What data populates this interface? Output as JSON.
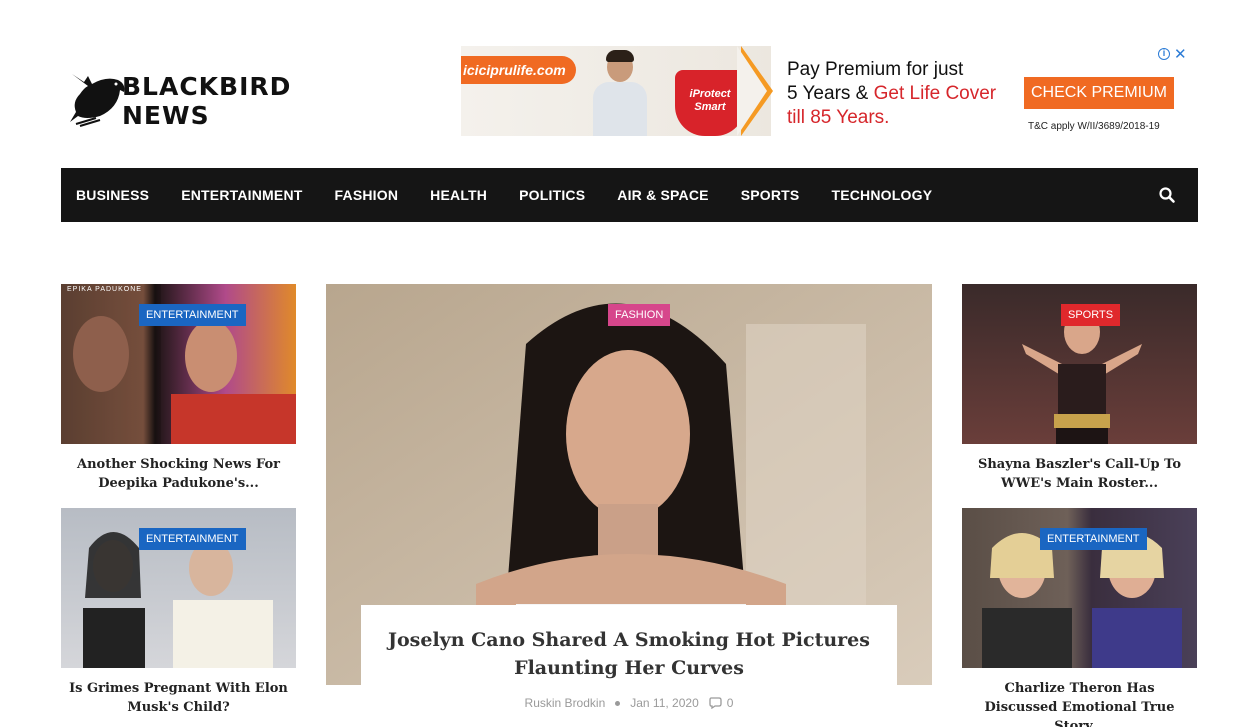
{
  "site": {
    "logo_text": "BLACKBIRD NEWS"
  },
  "ad": {
    "url_label": "iciciprulife.com",
    "badge": "iProtect Smart",
    "line1": "Pay Premium for just",
    "line2_prefix": "5 Years & ",
    "line2_highlight": "Get Life Cover",
    "line3": "till 85 Years.",
    "cta": "CHECK PREMIUM",
    "tc": "T&C apply W/II/3689/2018-19"
  },
  "nav": {
    "items": [
      "BUSINESS",
      "ENTERTAINMENT",
      "FASHION",
      "HEALTH",
      "POLITICS",
      "AIR & SPACE",
      "SPORTS",
      "TECHNOLOGY"
    ]
  },
  "cards": {
    "left_top": {
      "category": "ENTERTAINMENT",
      "title": "Another Shocking News For Deepika Padukone's...",
      "photo_caption": "EPIKA PADUKONE"
    },
    "left_bottom": {
      "category": "ENTERTAINMENT",
      "title": "Is Grimes Pregnant With Elon Musk's Child?"
    },
    "right_top": {
      "category": "SPORTS",
      "title": "Shayna Baszler's Call-Up To WWE's Main Roster..."
    },
    "right_bottom": {
      "category": "ENTERTAINMENT",
      "title": "Charlize Theron Has Discussed Emotional True Story..."
    }
  },
  "feature": {
    "category": "FASHION",
    "title": "Joselyn Cano Shared A Smoking Hot Pictures Flaunting Her Curves",
    "author": "Ruskin Brodkin",
    "date": "Jan 11, 2020",
    "comments": "0"
  },
  "colors": {
    "nav_bg": "#151515",
    "entertainment": "#1a66c2",
    "sports": "#e0282c",
    "fashion": "#d6468b",
    "ad_orange": "#f06a22"
  }
}
